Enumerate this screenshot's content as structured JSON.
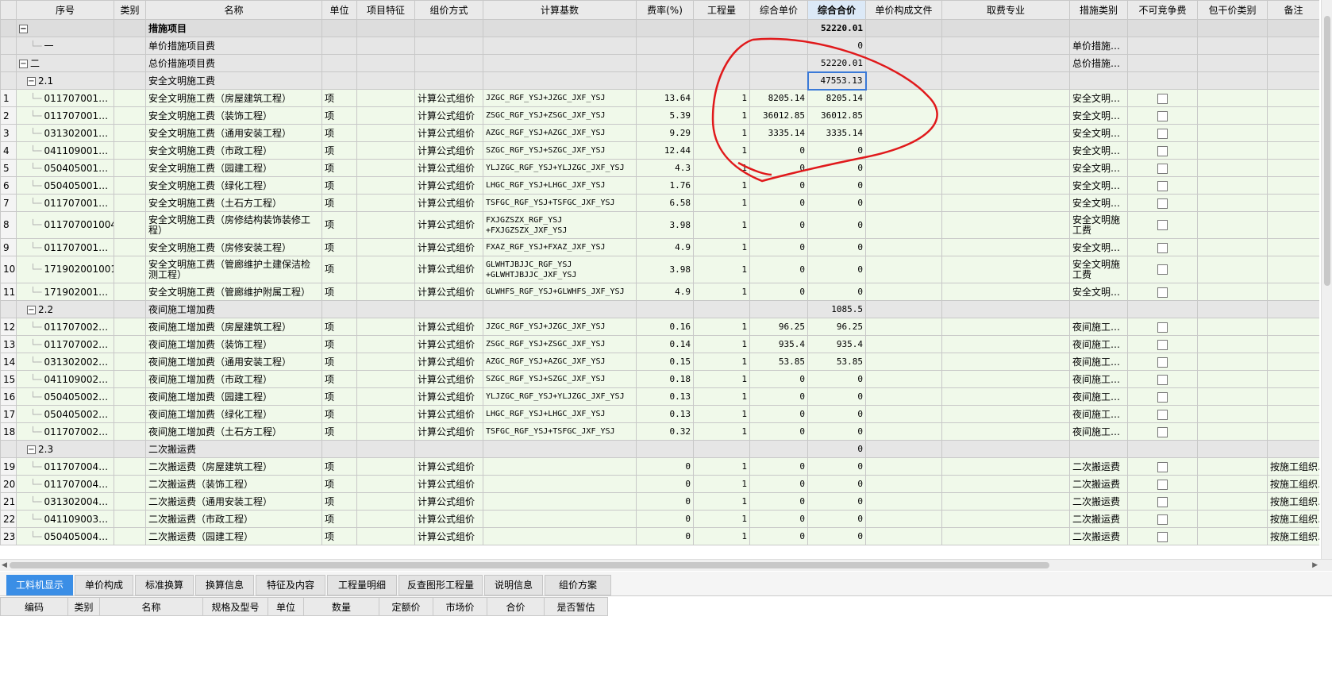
{
  "grid": {
    "columns": [
      "序号",
      "类别",
      "名称",
      "单位",
      "项目特征",
      "组价方式",
      "计算基数",
      "费率(%)",
      "工程量",
      "综合单价",
      "综合合价",
      "单价构成文件",
      "取费专业",
      "措施类别",
      "不可竞争费",
      "包干价类别",
      "备注"
    ],
    "active_column": 10,
    "rows": [
      {
        "kind": "top",
        "rn": "",
        "code": "",
        "toggle": "−",
        "name": "措施项目",
        "total": "52220.01"
      },
      {
        "kind": "group",
        "rn": "",
        "code": "一",
        "tree": true,
        "name": "单价措施项目费",
        "total": "0",
        "cat": "单价措施…"
      },
      {
        "kind": "group",
        "rn": "",
        "code": "二",
        "toggle": "−",
        "name": "总价措施项目费",
        "total": "52220.01",
        "cat": "总价措施…"
      },
      {
        "kind": "group",
        "rn": "",
        "code": "2.1",
        "toggle": "−",
        "indent": 1,
        "name": "安全文明施工费",
        "total": "47553.13",
        "selected": true
      },
      {
        "kind": "item",
        "rn": "1",
        "code": "011707001…",
        "name": "安全文明施工费（房屋建筑工程）",
        "unit": "项",
        "method": "计算公式组价",
        "base": "JZGC_RGF_YSJ+JZGC_JXF_YSJ",
        "rate": "13.64",
        "qty": "1",
        "price": "8205.14",
        "total": "8205.14",
        "cat": "安全文明…"
      },
      {
        "kind": "item",
        "rn": "2",
        "code": "011707001…",
        "name": "安全文明施工费（装饰工程）",
        "unit": "项",
        "method": "计算公式组价",
        "base": "ZSGC_RGF_YSJ+ZSGC_JXF_YSJ",
        "rate": "5.39",
        "qty": "1",
        "price": "36012.85",
        "total": "36012.85",
        "cat": "安全文明…"
      },
      {
        "kind": "item",
        "rn": "3",
        "code": "031302001…",
        "name": "安全文明施工费（通用安装工程）",
        "unit": "项",
        "method": "计算公式组价",
        "base": "AZGC_RGF_YSJ+AZGC_JXF_YSJ",
        "rate": "9.29",
        "qty": "1",
        "price": "3335.14",
        "total": "3335.14",
        "cat": "安全文明…"
      },
      {
        "kind": "item",
        "rn": "4",
        "code": "041109001…",
        "name": "安全文明施工费（市政工程）",
        "unit": "项",
        "method": "计算公式组价",
        "base": "SZGC_RGF_YSJ+SZGC_JXF_YSJ",
        "rate": "12.44",
        "qty": "1",
        "price": "0",
        "total": "0",
        "cat": "安全文明…"
      },
      {
        "kind": "item",
        "rn": "5",
        "code": "050405001…",
        "name": "安全文明施工费（园建工程）",
        "unit": "项",
        "method": "计算公式组价",
        "base": "YLJZGC_RGF_YSJ+YLJZGC_JXF_YSJ",
        "rate": "4.3",
        "qty": "1",
        "price": "0",
        "total": "0",
        "cat": "安全文明…"
      },
      {
        "kind": "item",
        "rn": "6",
        "code": "050405001…",
        "name": "安全文明施工费（绿化工程）",
        "unit": "项",
        "method": "计算公式组价",
        "base": "LHGC_RGF_YSJ+LHGC_JXF_YSJ",
        "rate": "1.76",
        "qty": "1",
        "price": "0",
        "total": "0",
        "cat": "安全文明…"
      },
      {
        "kind": "item",
        "rn": "7",
        "code": "011707001…",
        "name": "安全文明施工费（土石方工程）",
        "unit": "项",
        "method": "计算公式组价",
        "base": "TSFGC_RGF_YSJ+TSFGC_JXF_YSJ",
        "rate": "6.58",
        "qty": "1",
        "price": "0",
        "total": "0",
        "cat": "安全文明…"
      },
      {
        "kind": "item",
        "tall": true,
        "rn": "8",
        "code": "011707001004",
        "name": "安全文明施工费（房修结构装饰装修工程）",
        "unit": "项",
        "method": "计算公式组价",
        "base": "FXJGZSZX_RGF_YSJ +FXJGZSZX_JXF_YSJ",
        "rate": "3.98",
        "qty": "1",
        "price": "0",
        "total": "0",
        "cat": "安全文明施工费"
      },
      {
        "kind": "item",
        "rn": "9",
        "code": "011707001…",
        "name": "安全文明施工费（房修安装工程）",
        "unit": "项",
        "method": "计算公式组价",
        "base": "FXAZ_RGF_YSJ+FXAZ_JXF_YSJ",
        "rate": "4.9",
        "qty": "1",
        "price": "0",
        "total": "0",
        "cat": "安全文明…"
      },
      {
        "kind": "item",
        "tall": true,
        "rn": "10",
        "code": "171902001001",
        "name": "安全文明施工费（管廊维护土建保洁检测工程）",
        "unit": "项",
        "method": "计算公式组价",
        "base": "GLWHTJBJJC_RGF_YSJ +GLWHTJBJJC_JXF_YSJ",
        "rate": "3.98",
        "qty": "1",
        "price": "0",
        "total": "0",
        "cat": "安全文明施工费"
      },
      {
        "kind": "item",
        "rn": "11",
        "code": "171902001…",
        "name": "安全文明施工费（管廊维护附属工程）",
        "unit": "项",
        "method": "计算公式组价",
        "base": "GLWHFS_RGF_YSJ+GLWHFS_JXF_YSJ",
        "rate": "4.9",
        "qty": "1",
        "price": "0",
        "total": "0",
        "cat": "安全文明…"
      },
      {
        "kind": "group",
        "rn": "",
        "code": "2.2",
        "toggle": "−",
        "indent": 1,
        "name": "夜间施工增加费",
        "total": "1085.5"
      },
      {
        "kind": "item",
        "rn": "12",
        "code": "011707002…",
        "name": "夜间施工增加费（房屋建筑工程）",
        "unit": "项",
        "method": "计算公式组价",
        "base": "JZGC_RGF_YSJ+JZGC_JXF_YSJ",
        "rate": "0.16",
        "qty": "1",
        "price": "96.25",
        "total": "96.25",
        "cat": "夜间施工…"
      },
      {
        "kind": "item",
        "rn": "13",
        "code": "011707002…",
        "name": "夜间施工增加费（装饰工程）",
        "unit": "项",
        "method": "计算公式组价",
        "base": "ZSGC_RGF_YSJ+ZSGC_JXF_YSJ",
        "rate": "0.14",
        "qty": "1",
        "price": "935.4",
        "total": "935.4",
        "cat": "夜间施工…"
      },
      {
        "kind": "item",
        "rn": "14",
        "code": "031302002…",
        "name": "夜间施工增加费（通用安装工程）",
        "unit": "项",
        "method": "计算公式组价",
        "base": "AZGC_RGF_YSJ+AZGC_JXF_YSJ",
        "rate": "0.15",
        "qty": "1",
        "price": "53.85",
        "total": "53.85",
        "cat": "夜间施工…"
      },
      {
        "kind": "item",
        "rn": "15",
        "code": "041109002…",
        "name": "夜间施工增加费（市政工程）",
        "unit": "项",
        "method": "计算公式组价",
        "base": "SZGC_RGF_YSJ+SZGC_JXF_YSJ",
        "rate": "0.18",
        "qty": "1",
        "price": "0",
        "total": "0",
        "cat": "夜间施工…"
      },
      {
        "kind": "item",
        "rn": "16",
        "code": "050405002…",
        "name": "夜间施工增加费（园建工程）",
        "unit": "项",
        "method": "计算公式组价",
        "base": "YLJZGC_RGF_YSJ+YLJZGC_JXF_YSJ",
        "rate": "0.13",
        "qty": "1",
        "price": "0",
        "total": "0",
        "cat": "夜间施工…"
      },
      {
        "kind": "item",
        "rn": "17",
        "code": "050405002…",
        "name": "夜间施工增加费（绿化工程）",
        "unit": "项",
        "method": "计算公式组价",
        "base": "LHGC_RGF_YSJ+LHGC_JXF_YSJ",
        "rate": "0.13",
        "qty": "1",
        "price": "0",
        "total": "0",
        "cat": "夜间施工…"
      },
      {
        "kind": "item",
        "rn": "18",
        "code": "011707002…",
        "name": "夜间施工增加费（土石方工程）",
        "unit": "项",
        "method": "计算公式组价",
        "base": "TSFGC_RGF_YSJ+TSFGC_JXF_YSJ",
        "rate": "0.32",
        "qty": "1",
        "price": "0",
        "total": "0",
        "cat": "夜间施工…"
      },
      {
        "kind": "group",
        "rn": "",
        "code": "2.3",
        "toggle": "−",
        "indent": 1,
        "name": "二次搬运费",
        "total": "0"
      },
      {
        "kind": "item",
        "rn": "19",
        "code": "011707004…",
        "name": "二次搬运费（房屋建筑工程）",
        "unit": "项",
        "method": "计算公式组价",
        "base": "",
        "rate": "0",
        "qty": "1",
        "price": "0",
        "total": "0",
        "cat": "二次搬运费",
        "note": "按施工组织…"
      },
      {
        "kind": "item",
        "rn": "20",
        "code": "011707004…",
        "name": "二次搬运费（装饰工程）",
        "unit": "项",
        "method": "计算公式组价",
        "base": "",
        "rate": "0",
        "qty": "1",
        "price": "0",
        "total": "0",
        "cat": "二次搬运费",
        "note": "按施工组织…"
      },
      {
        "kind": "item",
        "rn": "21",
        "code": "031302004…",
        "name": "二次搬运费（通用安装工程）",
        "unit": "项",
        "method": "计算公式组价",
        "base": "",
        "rate": "0",
        "qty": "1",
        "price": "0",
        "total": "0",
        "cat": "二次搬运费",
        "note": "按施工组织…"
      },
      {
        "kind": "item",
        "rn": "22",
        "code": "041109003…",
        "name": "二次搬运费（市政工程）",
        "unit": "项",
        "method": "计算公式组价",
        "base": "",
        "rate": "0",
        "qty": "1",
        "price": "0",
        "total": "0",
        "cat": "二次搬运费",
        "note": "按施工组织…"
      },
      {
        "kind": "item",
        "rn": "23",
        "code": "050405004…",
        "name": "二次搬运费（园建工程）",
        "unit": "项",
        "method": "计算公式组价",
        "base": "",
        "rate": "0",
        "qty": "1",
        "price": "0",
        "total": "0",
        "cat": "二次搬运费",
        "note": "按施工组织…"
      }
    ]
  },
  "tabs": [
    "工料机显示",
    "单价构成",
    "标准换算",
    "换算信息",
    "特征及内容",
    "工程量明细",
    "反查图形工程量",
    "说明信息",
    "组价方案"
  ],
  "active_tab": 0,
  "sub_columns": [
    "编码",
    "类别",
    "名称",
    "规格及型号",
    "单位",
    "数量",
    "定额价",
    "市场价",
    "合价",
    "是否暂估"
  ],
  "colors": {
    "accent": "#3a8ee6",
    "item_bg": "#f0f9ea",
    "annotation": "#e0191b"
  }
}
